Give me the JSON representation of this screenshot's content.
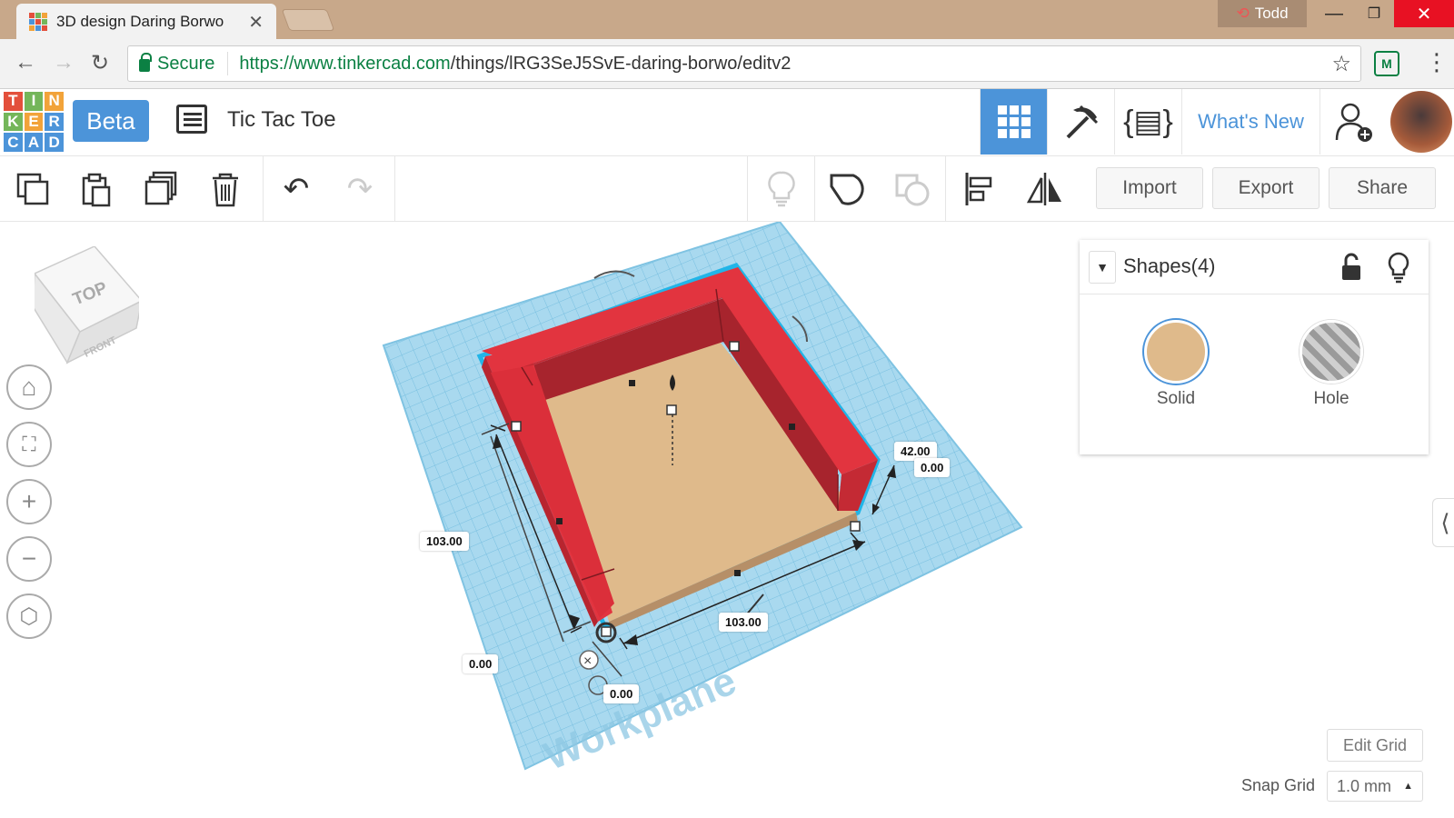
{
  "browser": {
    "tab_title": "3D design Daring Borwo",
    "user_name": "Todd",
    "secure_label": "Secure",
    "url_host": "https://www.tinkercad.com",
    "url_path": "/things/lRG3SeJ5SvE-daring-borwo/editv2"
  },
  "app": {
    "logo_letters": [
      "T",
      "I",
      "N",
      "K",
      "E",
      "R",
      "C",
      "A",
      "D"
    ],
    "beta_label": "Beta",
    "design_title": "Tic Tac Toe",
    "whats_new_label": "What's New"
  },
  "toolbar": {
    "import_label": "Import",
    "export_label": "Export",
    "share_label": "Share"
  },
  "viewcube": {
    "top_label": "TOP",
    "front_label": "FRONT"
  },
  "shapes_panel": {
    "title": "Shapes(4)",
    "solid_label": "Solid",
    "hole_label": "Hole",
    "solid_color": "#dfba8b"
  },
  "workplane": {
    "watermark": "Workplane",
    "dims": {
      "height": "42.00",
      "height_offset": "0.00",
      "length_left": "103.00",
      "length_bottom": "103.00",
      "origin_x": "0.00",
      "origin_y": "0.00"
    }
  },
  "grid": {
    "edit_grid_label": "Edit Grid",
    "snap_grid_label": "Snap Grid",
    "snap_value": "1.0 mm"
  },
  "colors": {
    "tinkercad_blue": "#4c94d9",
    "workplane": "#a9d9ef",
    "wall_red": "#db2f3a",
    "floor_tan": "#dfba8b"
  }
}
